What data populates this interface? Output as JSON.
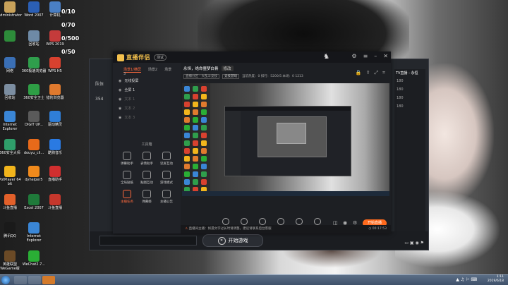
{
  "desktop": {
    "icons": [
      {
        "label": "Administrator",
        "color": "#c9a25a"
      },
      {
        "label": "Word 2007",
        "color": "#2b5fb5"
      },
      {
        "label": "计算机",
        "color": "#4a7fc4"
      },
      {
        "label": "",
        "color": "#2d8c3a"
      },
      {
        "label": "回收站",
        "color": "#6e8aa6"
      },
      {
        "label": "WPS 2019",
        "color": "#c43b3b"
      },
      {
        "label": "网络",
        "color": "#3a6fb5"
      },
      {
        "label": "360极速浏览器",
        "color": "#2f9e4c"
      },
      {
        "label": "WPS H5",
        "color": "#d8412f"
      },
      {
        "label": "回收站",
        "color": "#7c8ea1"
      },
      {
        "label": "360安全卫士",
        "color": "#2e9e45"
      },
      {
        "label": "猎豹浏览器",
        "color": "#e07a2e"
      },
      {
        "label": "Internet Explorer",
        "color": "#3a86d6"
      },
      {
        "label": "DIGIT UP...",
        "color": "#5a5a5a"
      },
      {
        "label": "驱动精灵",
        "color": "#2f7ed8"
      },
      {
        "label": "360安全大师",
        "color": "#2f9e6a"
      },
      {
        "label": "douyu_cli...",
        "color": "#e86a1a"
      },
      {
        "label": "酷狗音乐",
        "color": "#2a7ae2"
      },
      {
        "label": "PotPlayer 64 bit",
        "color": "#f2b51c"
      },
      {
        "label": "dyhelper5",
        "color": "#f08a1c"
      },
      {
        "label": "直播助手",
        "color": "#d12f2f"
      },
      {
        "label": "斗鱼直播",
        "color": "#e2602a"
      },
      {
        "label": "Excel 2007",
        "color": "#1f7a3a"
      },
      {
        "label": "斗鱼直播",
        "color": "#c5372c"
      },
      {
        "label": "腾讯QQ",
        "color": "#1a1a1a"
      },
      {
        "label": "Internet Explorer",
        "color": "#3a86d6"
      },
      {
        "label": "",
        "color": "#00000000"
      },
      {
        "label": "英雄联盟 WeGame版",
        "color": "#6b4a26"
      },
      {
        "label": "WeChat2.7...",
        "color": "#2aae35"
      },
      {
        "label": "",
        "color": "#00000000"
      }
    ],
    "tallies": [
      "0/10",
      "0/70",
      "0/500",
      "0/50"
    ]
  },
  "backwin": {
    "side_items": [
      "队伍",
      "354"
    ],
    "right_title": "TV直播 - 永恒",
    "right_rows": [
      "180",
      "180",
      "180",
      "180"
    ],
    "start_game": "开始游戏"
  },
  "app": {
    "logo": "直播伴侣",
    "version": "测试",
    "tabs": [
      "场景1/横屏",
      "场景2",
      "场景3"
    ],
    "scenes": [
      {
        "name": "无线投屏",
        "dim": false
      },
      {
        "name": "全屏 1",
        "dim": false
      },
      {
        "name": "文本 1",
        "dim": true
      },
      {
        "name": "文本 2",
        "dim": true
      },
      {
        "name": "文本 3",
        "dim": true
      }
    ],
    "tools_title": "工具箱",
    "tools": [
      {
        "label": "弹幕助手",
        "hot": false
      },
      {
        "label": "表情助手",
        "hot": false
      },
      {
        "label": "读屏互动",
        "hot": false
      },
      {
        "label": "全局贴纸",
        "hot": false
      },
      {
        "label": "贴图互动",
        "hot": false
      },
      {
        "label": "游戏模式",
        "hot": false
      },
      {
        "label": "主播任务",
        "hot": true
      },
      {
        "label": "弹幕姬",
        "hot": false
      },
      {
        "label": "主播公告",
        "hot": false
      }
    ],
    "room_title": "永恒，绝命噩梦白骨",
    "room_edit": "修改",
    "room_cat": "直播分区 - 大乱斗竞技",
    "room_cat2": "竞技游戏",
    "room_meta": "当前热度：0  排行：5200/5   本场：0  1213",
    "controls": [
      {
        "label": "屏幕共享"
      },
      {
        "label": "摄像头"
      },
      {
        "label": "游戏直播"
      },
      {
        "label": "语音直播"
      },
      {
        "label": "麦克风"
      },
      {
        "label": "扬声器"
      }
    ],
    "go_live": "开始直播",
    "status_warn": "直播间主播：如遇文字过长时请调整，建议请联系后台客服",
    "status_time": "00:17:53"
  },
  "taskbar": {
    "time": "1:11",
    "date": "2019/6/18"
  }
}
